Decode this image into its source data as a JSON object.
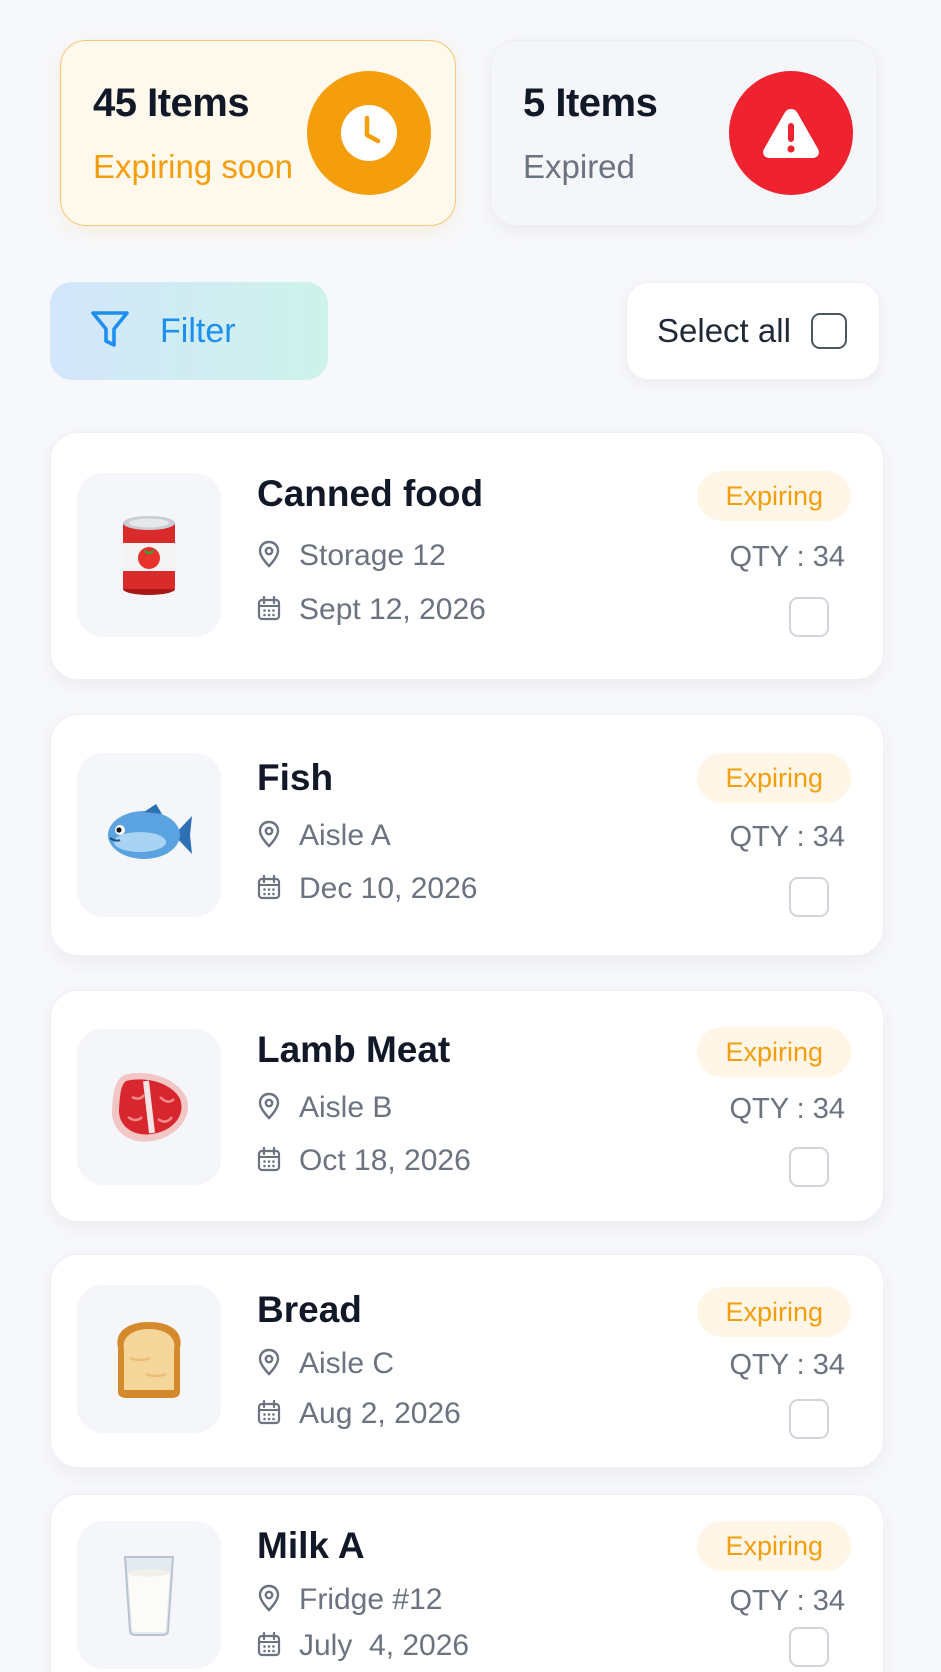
{
  "summary": {
    "expiring_soon": {
      "count": "45 Items",
      "label": "Expiring soon",
      "icon": "clock-icon",
      "color": "#f59e0b"
    },
    "expired": {
      "count": "5 Items",
      "label": "Expired",
      "icon": "warning-icon",
      "color": "#ef2230"
    }
  },
  "toolbar": {
    "filter_label": "Filter",
    "filter_icon": "filter-funnel-icon",
    "select_all_label": "Select all",
    "select_all_checked": false
  },
  "items": [
    {
      "name": "Canned food",
      "location": "Storage 12",
      "date": "Sept 12, 2026",
      "status": "Expiring",
      "qty": "QTY : 34",
      "image": "tomato-can-image",
      "checked": false
    },
    {
      "name": "Fish",
      "location": "Aisle A",
      "date": "Dec 10, 2026",
      "status": "Expiring",
      "qty": "QTY : 34",
      "image": "fish-image",
      "checked": false
    },
    {
      "name": "Lamb Meat",
      "location": "Aisle B",
      "date": "Oct 18, 2026",
      "status": "Expiring",
      "qty": "QTY : 34",
      "image": "meat-image",
      "checked": false
    },
    {
      "name": "Bread",
      "location": "Aisle C",
      "date": "Aug 2, 2026",
      "status": "Expiring",
      "qty": "QTY : 34",
      "image": "bread-image",
      "checked": false
    },
    {
      "name": "Milk A",
      "location": "Fridge #12",
      "date": "July  4, 2026",
      "status": "Expiring",
      "qty": "QTY : 34",
      "image": "milk-glass-image",
      "checked": false
    }
  ]
}
